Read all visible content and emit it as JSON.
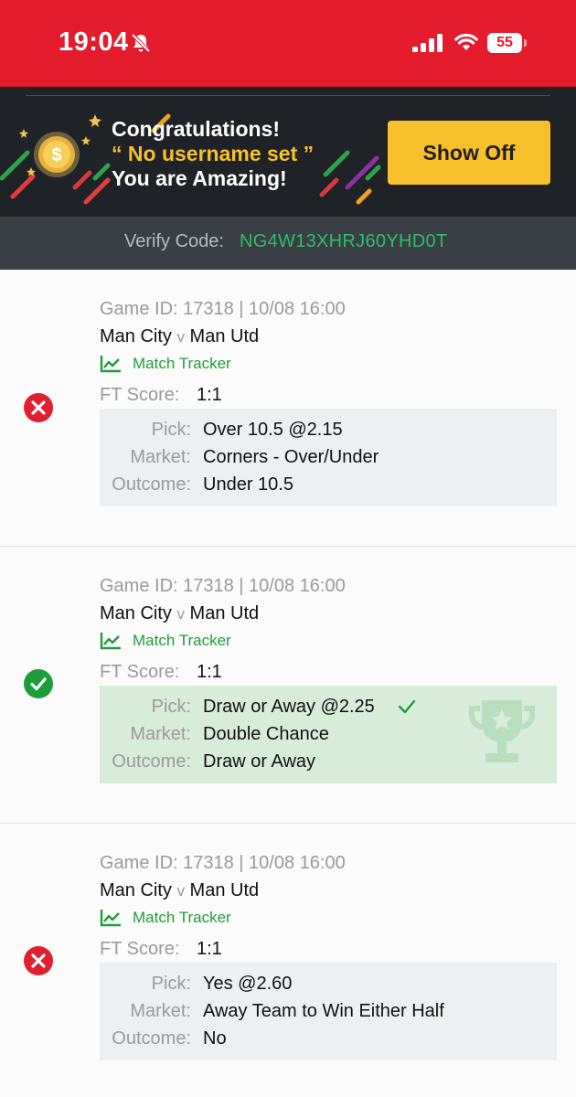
{
  "status_bar": {
    "time": "19:04",
    "battery": "55"
  },
  "banner": {
    "title": "Congratulations!",
    "username": "“ No username set ”",
    "subtitle": "You are Amazing!",
    "button_label": "Show Off"
  },
  "verify": {
    "label": "Verify Code:",
    "code": "NG4W13XHRJ60YHD0T"
  },
  "bets": [
    {
      "result": "lost",
      "game_id": "Game ID: 17318 | 10/08 16:00",
      "home": "Man City",
      "vs": "v",
      "away": "Man Utd",
      "tracker": "Match Tracker",
      "ft_label": "FT Score:",
      "ft_score": "1:1",
      "pick_label": "Pick:",
      "pick": "Over 10.5 @2.15",
      "market_label": "Market:",
      "market": "Corners - Over/Under",
      "outcome_label": "Outcome:",
      "outcome": "Under 10.5"
    },
    {
      "result": "won",
      "game_id": "Game ID: 17318 | 10/08 16:00",
      "home": "Man City",
      "vs": "v",
      "away": "Man Utd",
      "tracker": "Match Tracker",
      "ft_label": "FT Score:",
      "ft_score": "1:1",
      "pick_label": "Pick:",
      "pick": "Draw or Away @2.25",
      "market_label": "Market:",
      "market": "Double Chance",
      "outcome_label": "Outcome:",
      "outcome": "Draw or Away"
    },
    {
      "result": "lost",
      "game_id": "Game ID: 17318 | 10/08 16:00",
      "home": "Man City",
      "vs": "v",
      "away": "Man Utd",
      "tracker": "Match Tracker",
      "ft_label": "FT Score:",
      "ft_score": "1:1",
      "pick_label": "Pick:",
      "pick": "Yes @2.60",
      "market_label": "Market:",
      "market": "Away Team to Win Either Half",
      "outcome_label": "Outcome:",
      "outcome": "No"
    }
  ],
  "colors": {
    "brand_red": "#e41b2c",
    "accent_yellow": "#f8c12b",
    "win_green": "#1f9d3a",
    "loss_red": "#e0202f"
  },
  "icons": [
    "mute-icon",
    "signal-icon",
    "wifi-icon",
    "coin-icon",
    "loss-icon",
    "win-icon",
    "chart-icon",
    "check-icon",
    "trophy-icon"
  ]
}
